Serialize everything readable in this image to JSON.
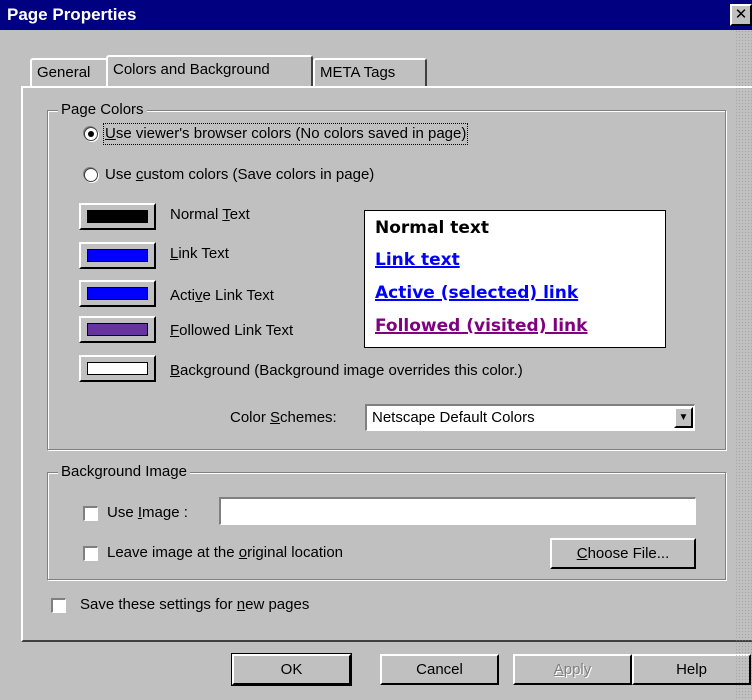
{
  "window": {
    "title": "Page Properties",
    "close_glyph": "✕"
  },
  "tabs": [
    {
      "label": "General"
    },
    {
      "label": "Colors and Background",
      "active": true
    },
    {
      "label": "META Tags"
    }
  ],
  "page_colors": {
    "group_label": "Page Colors",
    "radio_browser": {
      "pre": "",
      "key": "U",
      "post": "se viewer's browser colors (No colors saved in page)",
      "selected": true
    },
    "radio_custom": {
      "pre": "Use ",
      "key": "c",
      "post": "ustom colors (Save colors in page)",
      "selected": false
    },
    "color_items": [
      {
        "pre": "Normal ",
        "key": "T",
        "post": "ext",
        "color": "#000000"
      },
      {
        "pre": "",
        "key": "L",
        "post": "ink Text",
        "color": "#0000ff"
      },
      {
        "pre": "Acti",
        "key": "v",
        "post": "e Link Text",
        "color": "#0000ff"
      },
      {
        "pre": "",
        "key": "F",
        "post": "ollowed Link Text",
        "color": "#6633a0"
      },
      {
        "pre": "",
        "key": "B",
        "post": "ackground (Background image overrides this color.)",
        "color": "#ffffff"
      }
    ],
    "preview": {
      "normal": "Normal text",
      "link": "Link text",
      "active": "Active (selected) link",
      "followed": "Followed (visited) link",
      "normal_color": "#000000",
      "link_color": "#0000ff",
      "active_color": "#0000ff",
      "followed_color": "#800080"
    },
    "color_schemes": {
      "pre": "Color ",
      "key": "S",
      "post": "chemes:",
      "value": "Netscape Default Colors"
    }
  },
  "background_image": {
    "group_label": "Background Image",
    "use_image": {
      "pre": "Use ",
      "key": "I",
      "post": "mage :",
      "checked": false
    },
    "image_path": "",
    "leave_original": {
      "pre": "Leave image at the ",
      "key": "o",
      "post": "riginal location",
      "checked": false
    },
    "choose_file": {
      "pre": "",
      "key": "C",
      "post": "hoose File..."
    }
  },
  "save_settings": {
    "pre": "Save these settings for ",
    "key": "n",
    "post": "ew pages",
    "checked": false
  },
  "buttons": {
    "ok": "OK",
    "cancel": "Cancel",
    "apply": {
      "pre": "",
      "key": "A",
      "post": "pply"
    },
    "help": "Help"
  }
}
